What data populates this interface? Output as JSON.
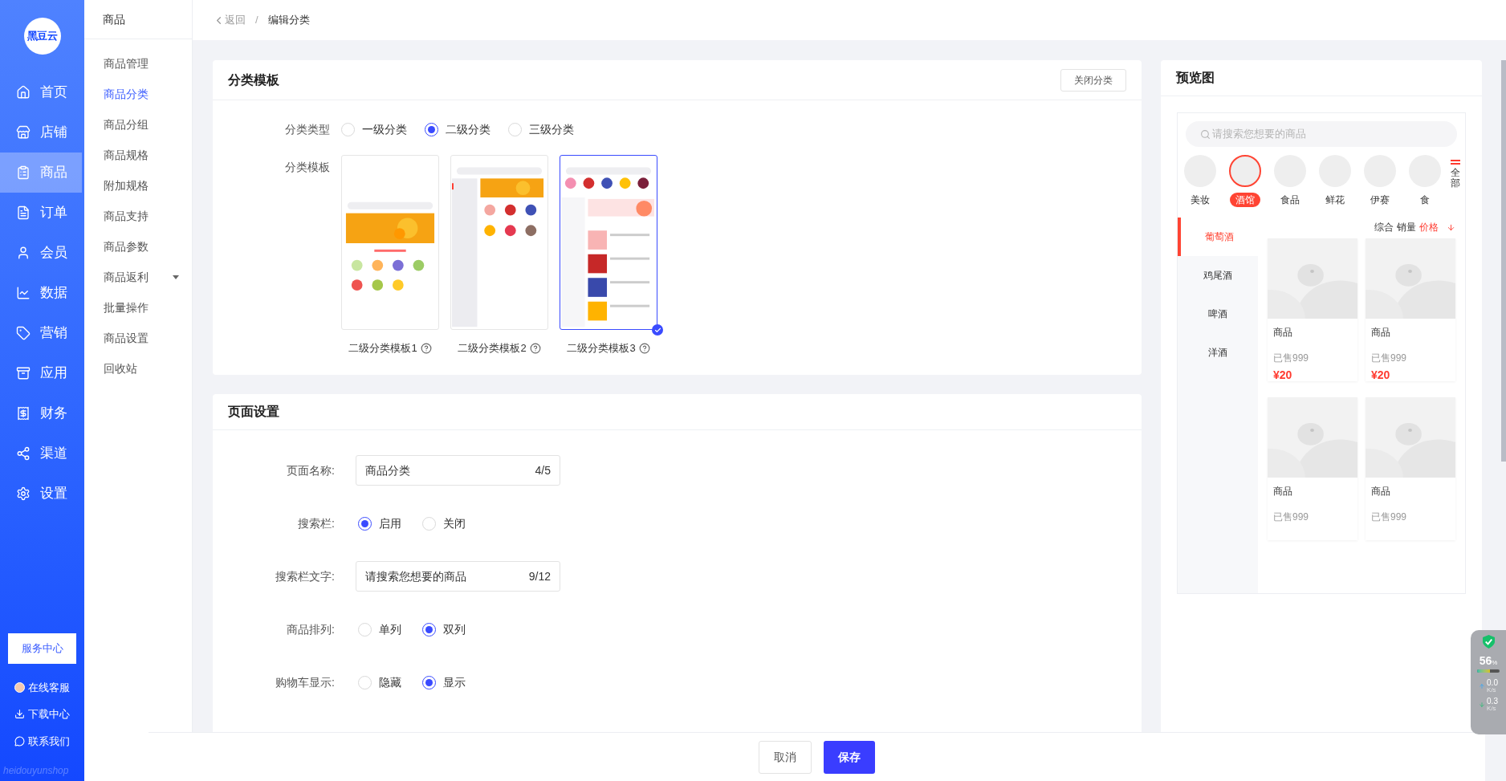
{
  "sidebar": {
    "logo": "黑豆云",
    "items": [
      {
        "label": "首页",
        "selected": false
      },
      {
        "label": "店铺",
        "selected": false
      },
      {
        "label": "商品",
        "selected": true
      },
      {
        "label": "订单",
        "selected": false
      },
      {
        "label": "会员",
        "selected": false
      },
      {
        "label": "数据",
        "selected": false
      },
      {
        "label": "营销",
        "selected": false
      },
      {
        "label": "应用",
        "selected": false
      },
      {
        "label": "财务",
        "selected": false
      },
      {
        "label": "渠道",
        "selected": false
      },
      {
        "label": "设置",
        "selected": false
      }
    ],
    "service_button": "服务中心",
    "links": [
      "在线客服",
      "下载中心",
      "联系我们"
    ],
    "brand_text": "heidouyunshop"
  },
  "subnav": {
    "title": "商品",
    "items": [
      {
        "label": "商品管理",
        "selected": false,
        "expandable": false
      },
      {
        "label": "商品分类",
        "selected": true,
        "expandable": false
      },
      {
        "label": "商品分组",
        "selected": false,
        "expandable": false
      },
      {
        "label": "商品规格",
        "selected": false,
        "expandable": false
      },
      {
        "label": "附加规格",
        "selected": false,
        "expandable": false
      },
      {
        "label": "商品支持",
        "selected": false,
        "expandable": false
      },
      {
        "label": "商品参数",
        "selected": false,
        "expandable": false
      },
      {
        "label": "商品返利",
        "selected": false,
        "expandable": true
      },
      {
        "label": "批量操作",
        "selected": false,
        "expandable": false
      },
      {
        "label": "商品设置",
        "selected": false,
        "expandable": false
      },
      {
        "label": "回收站",
        "selected": false,
        "expandable": false
      }
    ]
  },
  "breadcrumb": {
    "back": "返回",
    "separator": "/",
    "current": "编辑分类"
  },
  "template_card": {
    "title": "分类模板",
    "close_button": "关闭分类",
    "type_label": "分类类型",
    "types": [
      {
        "label": "一级分类",
        "selected": false
      },
      {
        "label": "二级分类",
        "selected": true
      },
      {
        "label": "三级分类",
        "selected": false
      }
    ],
    "template_label": "分类模板",
    "templates": [
      {
        "name": "二级分类模板1",
        "selected": false
      },
      {
        "name": "二级分类模板2",
        "selected": false
      },
      {
        "name": "二级分类模板3",
        "selected": true
      }
    ]
  },
  "page_settings": {
    "title": "页面设置",
    "fields": [
      {
        "kind": "text",
        "label": "页面名称:",
        "value": "商品分类",
        "count": "4/5"
      },
      {
        "kind": "radio",
        "label": "搜索栏:",
        "options": [
          {
            "label": "启用",
            "selected": true
          },
          {
            "label": "关闭",
            "selected": false
          }
        ]
      },
      {
        "kind": "text",
        "label": "搜索栏文字:",
        "value": "请搜索您想要的商品",
        "count": "9/12"
      },
      {
        "kind": "radio",
        "label": "商品排列:",
        "options": [
          {
            "label": "单列",
            "selected": false
          },
          {
            "label": "双列",
            "selected": true
          }
        ]
      },
      {
        "kind": "radio",
        "label": "购物车显示:",
        "options": [
          {
            "label": "隐藏",
            "selected": false
          },
          {
            "label": "显示",
            "selected": true
          }
        ]
      }
    ]
  },
  "preview": {
    "title": "预览图",
    "search_placeholder": "请搜索您想要的商品",
    "categories": [
      {
        "label": "美妆",
        "selected": false
      },
      {
        "label": "酒馆",
        "selected": true
      },
      {
        "label": "食品",
        "selected": false
      },
      {
        "label": "鲜花",
        "selected": false
      },
      {
        "label": "伊赛",
        "selected": false
      },
      {
        "label": "食",
        "selected": false
      }
    ],
    "all_button": "全部",
    "side_items": [
      {
        "label": "葡萄酒",
        "selected": true
      },
      {
        "label": "鸡尾酒",
        "selected": false
      },
      {
        "label": "啤酒",
        "selected": false
      },
      {
        "label": "洋酒",
        "selected": false
      }
    ],
    "sort": [
      {
        "label": "综合",
        "selected": false
      },
      {
        "label": "销量",
        "selected": false
      },
      {
        "label": "价格",
        "selected": true
      }
    ],
    "products": [
      {
        "name": "商品",
        "sold": "已售999",
        "price": "¥20"
      },
      {
        "name": "商品",
        "sold": "已售999",
        "price": "¥20"
      },
      {
        "name": "商品",
        "sold": "已售999"
      },
      {
        "name": "商品",
        "sold": "已售999"
      }
    ]
  },
  "footer": {
    "buttons": [
      {
        "label": "取消",
        "kind": "secondary"
      },
      {
        "label": "保存",
        "kind": "primary"
      }
    ]
  },
  "monitor": {
    "percent": "56",
    "unit": "%",
    "level": 0.56,
    "upload": "0.0",
    "upload_unit": "K/s",
    "download": "0.3",
    "download_unit": "K/s"
  }
}
